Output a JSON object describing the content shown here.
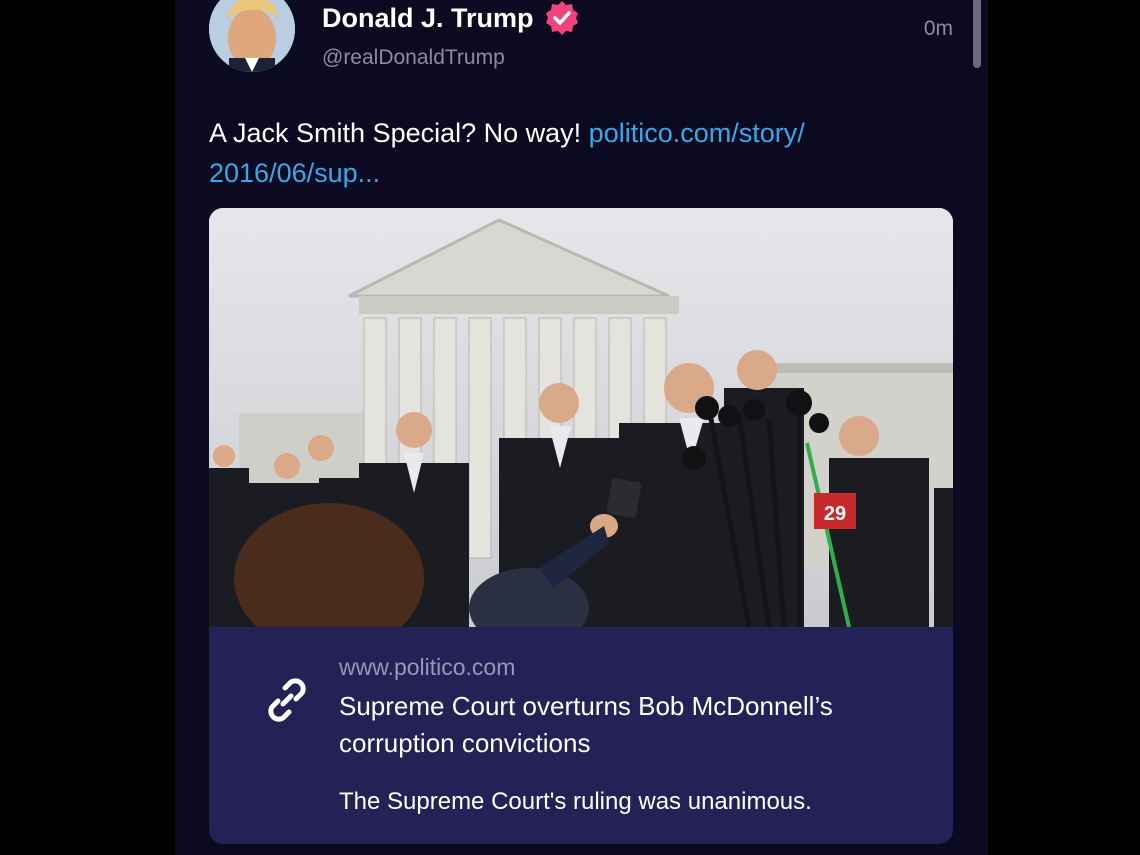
{
  "post": {
    "author_name": "Donald J. Trump",
    "author_handle": "@realDonaldTrump",
    "timestamp": "0m",
    "verified_icon": "verified-badge-icon",
    "text_plain": "A Jack Smith Special? No way! ",
    "text_link_line1": "politico.com/story/",
    "text_link_line2": "2016/06/sup..."
  },
  "link_card": {
    "icon": "link-icon",
    "domain": "www.politico.com",
    "title": "Supreme Court overturns Bob McDonnell’s corruption convictions",
    "description": "The Supreme Court's ruling was unanimous.",
    "image_caption_badge": "29"
  },
  "colors": {
    "background": "#000000",
    "panel": "#0c0a21",
    "card": "#242157",
    "link": "#35a9ea",
    "verified": "#f0457c",
    "muted_text": "#8d8ba2"
  }
}
